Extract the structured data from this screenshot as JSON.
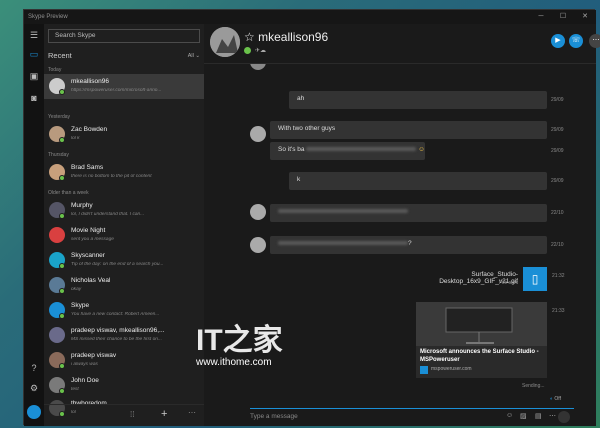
{
  "window": {
    "title": "Skype Preview"
  },
  "sidebar": {
    "search_placeholder": "Search Skype",
    "recent_label": "Recent",
    "filter_label": "All",
    "sections": {
      "today": "Today",
      "yesterday": "Yesterday",
      "thursday": "Thursday",
      "older": "Older than a week"
    },
    "items": [
      {
        "name": "mkeallison96",
        "sub": "https://mspoweruser.com/microsoft-anno..."
      },
      {
        "name": "Zac Bowden",
        "sub": "lol k"
      },
      {
        "name": "Brad Sams",
        "sub": "there is no bottom to the pit of content"
      },
      {
        "name": "Murphy",
        "sub": "lol, I didn't understand that. I can..."
      },
      {
        "name": "Movie Night",
        "sub": "sent you a message"
      },
      {
        "name": "Skyscanner",
        "sub": "Tip of the day: on the end of a search you..."
      },
      {
        "name": "Nicholas Veal",
        "sub": "okay"
      },
      {
        "name": "Skype",
        "sub": "You have a new contact: Robert Ameen..."
      },
      {
        "name": "pradeep viswav, mkeallison96,...",
        "sub": "MS missed their chance to be the first on..."
      },
      {
        "name": "pradeep viswav",
        "sub": "i always was"
      },
      {
        "name": "John Doe",
        "sub": "test"
      },
      {
        "name": "thwboredom",
        "sub": "lol"
      }
    ]
  },
  "chat": {
    "contact_name": "mkeallison96",
    "messages": [
      {
        "text": "ah",
        "time": "29/09"
      },
      {
        "text": "With two other guys",
        "time": "29/09"
      },
      {
        "text": "So it's ba",
        "time": "29/09"
      },
      {
        "text": "k",
        "time": "29/09"
      },
      {
        "text": "",
        "time": "22/10"
      },
      {
        "text": "?",
        "time": "22/10"
      },
      {
        "text": "Surface_Studio-Desktop_16x9_GIF_v21.gif",
        "time": "21:32",
        "status": "File sent"
      },
      {
        "link_title": "Microsoft announces the Surface Studio - MSPoweruser",
        "link_site": "mspoweruser.com",
        "time": "21:33"
      }
    ],
    "sending": "Sending...",
    "off_label": "Off",
    "compose_placeholder": "Type a message"
  },
  "watermark": {
    "logo": "IT之家",
    "url": "www.ithome.com"
  },
  "colors": {
    "accent": "#1a8fd6",
    "presence": "#6ac24b",
    "bubble": "#333333",
    "window_bg": "#191919"
  }
}
